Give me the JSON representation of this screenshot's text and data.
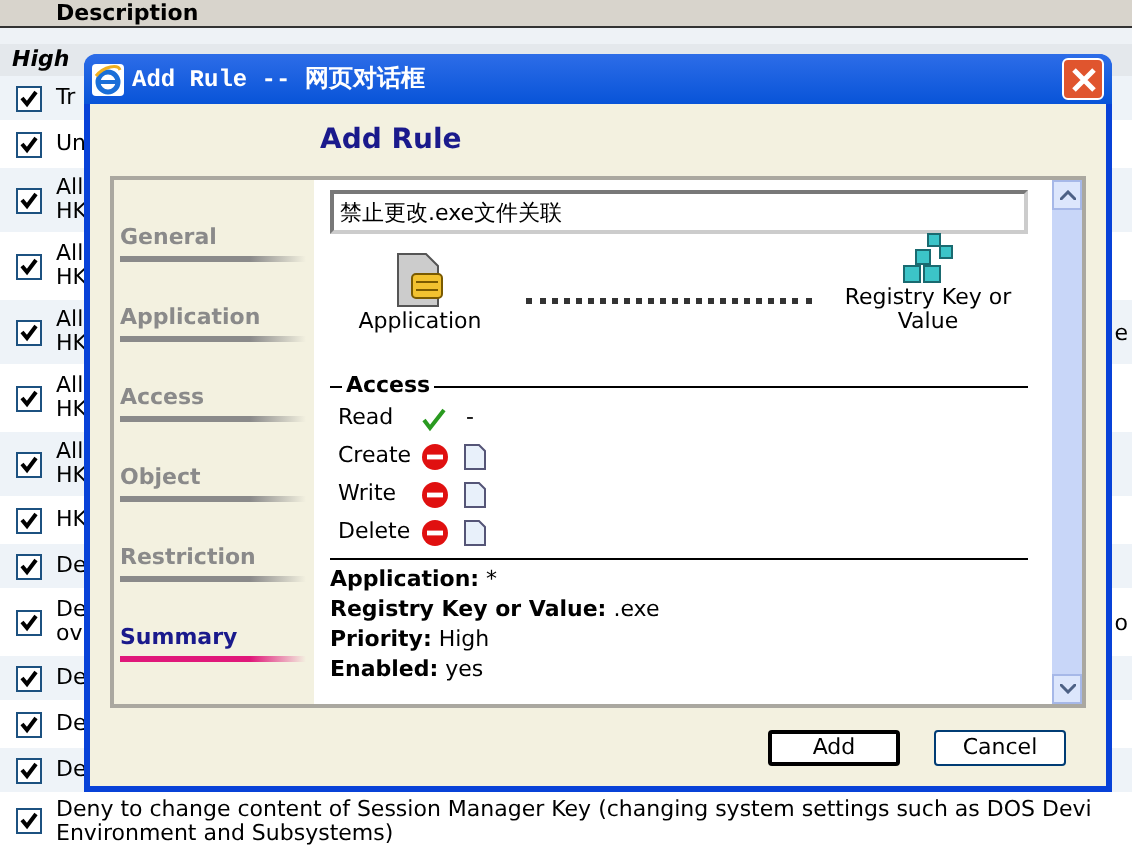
{
  "table": {
    "header": "Description",
    "group": "High",
    "rows": [
      {
        "checked": true,
        "lines": [
          "Tr"
        ]
      },
      {
        "checked": true,
        "lines": [
          "Un"
        ]
      },
      {
        "checked": true,
        "lines": [
          "All",
          "HK"
        ]
      },
      {
        "checked": true,
        "lines": [
          "All",
          "HK"
        ]
      },
      {
        "checked": true,
        "lines": [
          "All",
          "HK"
        ],
        "right": "e"
      },
      {
        "checked": true,
        "lines": [
          "All",
          "HK"
        ]
      },
      {
        "checked": true,
        "lines": [
          "All",
          "HK"
        ]
      },
      {
        "checked": true,
        "lines": [
          "HK"
        ]
      },
      {
        "checked": true,
        "lines": [
          "De"
        ]
      },
      {
        "checked": true,
        "lines": [
          "De",
          "ov"
        ],
        "right": "o"
      },
      {
        "checked": true,
        "lines": [
          "De"
        ]
      },
      {
        "checked": true,
        "lines": [
          "De"
        ]
      },
      {
        "checked": true,
        "lines": [
          "De"
        ]
      },
      {
        "checked": true,
        "lines": [
          "Deny to change content of Session Manager Key (changing system settings such as DOS Devi",
          "Environment and Subsystems)"
        ]
      }
    ]
  },
  "dialog": {
    "title": "Add Rule -- 网页对话框",
    "heading": "Add Rule",
    "nav": [
      {
        "label": "General",
        "selected": false
      },
      {
        "label": "Application",
        "selected": false
      },
      {
        "label": "Access",
        "selected": false
      },
      {
        "label": "Object",
        "selected": false
      },
      {
        "label": "Restriction",
        "selected": false
      },
      {
        "label": "Summary",
        "selected": true
      }
    ],
    "name_value": "禁止更改.exe文件关联",
    "source": "Application",
    "target": "Registry Key or Value",
    "access_title": "Access",
    "access": [
      {
        "label": "Read",
        "allowed": true,
        "kind": "note",
        "note": "-"
      },
      {
        "label": "Create",
        "allowed": false,
        "kind": "file"
      },
      {
        "label": "Write",
        "allowed": false,
        "kind": "file"
      },
      {
        "label": "Delete",
        "allowed": false,
        "kind": "file"
      }
    ],
    "summary": [
      {
        "label": "Application:",
        "value": "*"
      },
      {
        "label": "Registry Key or Value:",
        "value": ".exe"
      },
      {
        "label": "Priority:",
        "value": "High"
      },
      {
        "label": "Enabled:",
        "value": "yes"
      }
    ],
    "buttons": [
      {
        "label": "Add",
        "default": true
      },
      {
        "label": "Cancel",
        "default": false
      }
    ]
  }
}
